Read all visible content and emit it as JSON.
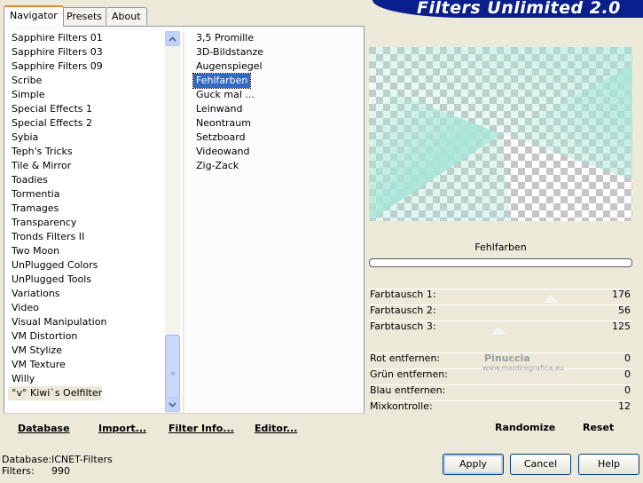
{
  "tabs": [
    "Navigator",
    "Presets",
    "About"
  ],
  "title": "Filters Unlimited 2.0",
  "categories": [
    "Sapphire Filters 01",
    "Sapphire Filters 03",
    "Sapphire Filters 09",
    "Scribe",
    "Simple",
    "Special Effects 1",
    "Special Effects 2",
    "Sybia",
    "Teph's Tricks",
    "Tile & Mirror",
    "Toadies",
    "Tormentia",
    "Tramages",
    "Transparency",
    "Tronds Filters II",
    "Two Moon",
    "UnPlugged Colors",
    "UnPlugged Tools",
    "Variations",
    "Video",
    "Visual Manipulation",
    "VM Distortion",
    "VM Stylize",
    "VM Texture",
    "Willy",
    "°v° Kiwi`s Oelfilter"
  ],
  "filters": [
    "3,5 Promille",
    "3D-Bildstanze",
    "Augenspiegel",
    "Fehlfarben",
    "Guck mal ...",
    "Leinwand",
    "Neontraum",
    "Setzboard",
    "Videowand",
    "Zig-Zack"
  ],
  "left_buttons": {
    "database": "Database",
    "import": "Import...",
    "filter_info": "Filter Info...",
    "editor": "Editor..."
  },
  "selected_filter": "Fehlfarben",
  "params": [
    {
      "label": "Farbtausch 1:",
      "value": "176"
    },
    {
      "label": "Farbtausch 2:",
      "value": "56"
    },
    {
      "label": "Farbtausch 3:",
      "value": "125"
    },
    {
      "label": "Rot entfernen:",
      "value": "0"
    },
    {
      "label": "Grün entfernen:",
      "value": "0"
    },
    {
      "label": "Blau entfernen:",
      "value": "0"
    },
    {
      "label": "Mixkontrolle:",
      "value": "12"
    }
  ],
  "right_buttons": {
    "randomize": "Randomize",
    "reset": "Reset"
  },
  "watermark": {
    "name": "Pinuccia",
    "site": "www.maidiregrafica.eu"
  },
  "footer": {
    "database_label": "Database:",
    "database_value": "ICNET-Filters",
    "filters_label": "Filters:",
    "filters_value": "990"
  },
  "dialog_buttons": {
    "apply": "Apply",
    "cancel": "Cancel",
    "help": "Help"
  },
  "colors": {
    "accent": "#316ac5",
    "banner": "#0b1f8c",
    "preview_teal": "#a8e6d8"
  }
}
